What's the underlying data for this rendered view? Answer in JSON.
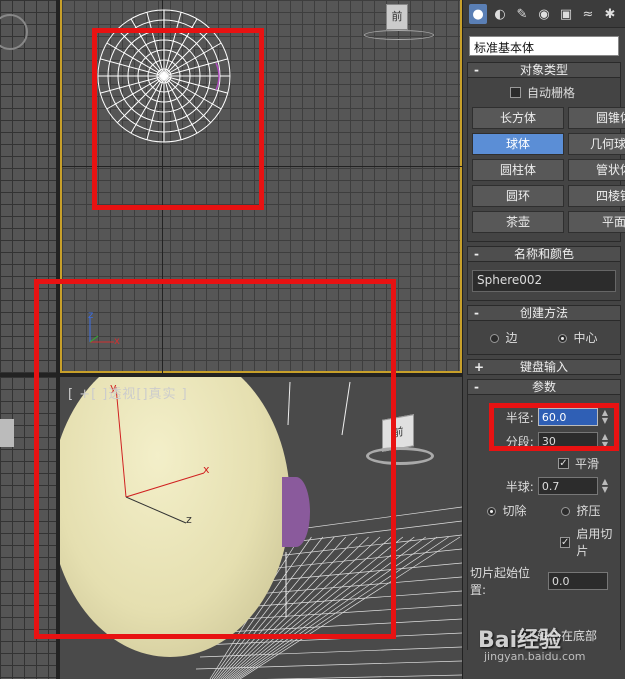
{
  "viewport": {
    "top_label": "",
    "persp_label": "[ +[ ]透视[]真实 ]",
    "cube_top_label": "前",
    "cube_persp_label": "前",
    "axis_z": "z",
    "axis_x": "x",
    "axis_y": "y"
  },
  "panel": {
    "tabs": [
      {
        "icon": "create-icon",
        "glyph": "●",
        "active": true
      },
      {
        "icon": "modify-icon",
        "glyph": "◐",
        "active": false
      },
      {
        "icon": "hierarchy-icon",
        "glyph": "✎",
        "active": false
      },
      {
        "icon": "motion-icon",
        "glyph": "◉",
        "active": false
      },
      {
        "icon": "display-icon",
        "glyph": "▣",
        "active": false
      },
      {
        "icon": "utilities-icon",
        "glyph": "≈",
        "active": false
      },
      {
        "icon": "star-icon",
        "glyph": "✱",
        "active": false
      }
    ],
    "category": "标准基本体",
    "object_type": {
      "title": "对象类型",
      "autogrid": "自动栅格",
      "buttons": [
        "长方体",
        "圆锥体",
        "球体",
        "几何球体",
        "圆柱体",
        "管状体",
        "圆环",
        "四棱锥",
        "茶壶",
        "平面"
      ],
      "active": "球体"
    },
    "name_color": {
      "title": "名称和颜色",
      "name": "Sphere002"
    },
    "creation_method": {
      "title": "创建方法",
      "option_edge": "边",
      "option_center": "中心"
    },
    "keyboard_entry": {
      "title": "键盘输入"
    },
    "parameters": {
      "title": "参数",
      "radius_label": "半径:",
      "radius_value": "60.0",
      "segments_label": "分段:",
      "segments_value": "30",
      "smooth_label": "平滑",
      "hemisphere_label": "半球:",
      "hemisphere_value": "0.7",
      "chop_label": "切除",
      "squash_label": "挤压",
      "slice_on_label": "启用切片",
      "slice_from_label": "切片起始位置:",
      "slice_from_value": "0.0",
      "base_to_pivot_label": "轴心在底部"
    }
  },
  "watermark": {
    "brand": "Bai经验",
    "url": "jingyan.baidu.com"
  }
}
